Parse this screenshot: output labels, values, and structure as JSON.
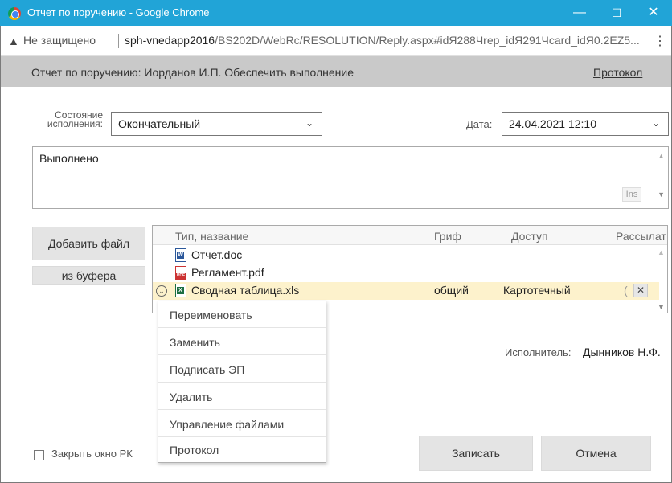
{
  "window": {
    "title": "Отчет по поручению - Google Chrome",
    "controls": {
      "minimize": "—",
      "maximize": "☐",
      "close": "✕"
    }
  },
  "address_bar": {
    "warning_icon": "▲",
    "security_text": "Не защищено",
    "host": "sph-vnedapp2016",
    "path": "/BS202D/WebRc/RESOLUTION/Reply.aspx#idЯ288Чrep_idЯ291Чcard_idЯ0.2EZ5...",
    "menu_icon": "⋮"
  },
  "header": {
    "title": "Отчет по поручению: Иорданов И.П. Обеспечить выполнение",
    "protocol_link": "Протокол"
  },
  "form": {
    "state_label_line1": "Состояние",
    "state_label_line2": "исполнения:",
    "state_value": "Окончательный",
    "date_label": "Дата:",
    "date_value": "24.04.2021 12:10",
    "dropdown_arrow": "⌄",
    "report_text": "Выполнено",
    "ins_label": "Ins"
  },
  "files": {
    "add_file_button": "Добавить файл",
    "from_buffer_button": "из буфера",
    "columns": [
      "Тип, название",
      "Гриф",
      "Доступ",
      "Рассылат"
    ],
    "rows": [
      {
        "name": "Отчет.doc",
        "icon": "word-icon",
        "grif": "",
        "access": ""
      },
      {
        "name": "Регламент.pdf",
        "icon": "pdf-icon",
        "grif": "",
        "access": ""
      },
      {
        "name": "Сводная таблица.xls",
        "icon": "excel-icon",
        "grif": "общий",
        "access": "Картотечный",
        "extra": "("
      }
    ],
    "delete_icon": "✕",
    "row_menu_icon": "⌄"
  },
  "context_menu": {
    "items": [
      "Переименовать",
      "Заменить",
      "Подписать ЭП",
      "Удалить",
      "Управление файлами",
      "Протокол"
    ]
  },
  "executor": {
    "label": "Исполнитель:",
    "name": "Дынников Н.Ф."
  },
  "footer": {
    "close_checkbox_label": "Закрыть окно РК",
    "save_button": "Записать",
    "cancel_button": "Отмена"
  },
  "colors": {
    "titlebar": "#21a4d7",
    "header_bg": "#c9c9c9",
    "selected_row": "#fdf2cc",
    "button_bg": "#e4e4e4"
  }
}
